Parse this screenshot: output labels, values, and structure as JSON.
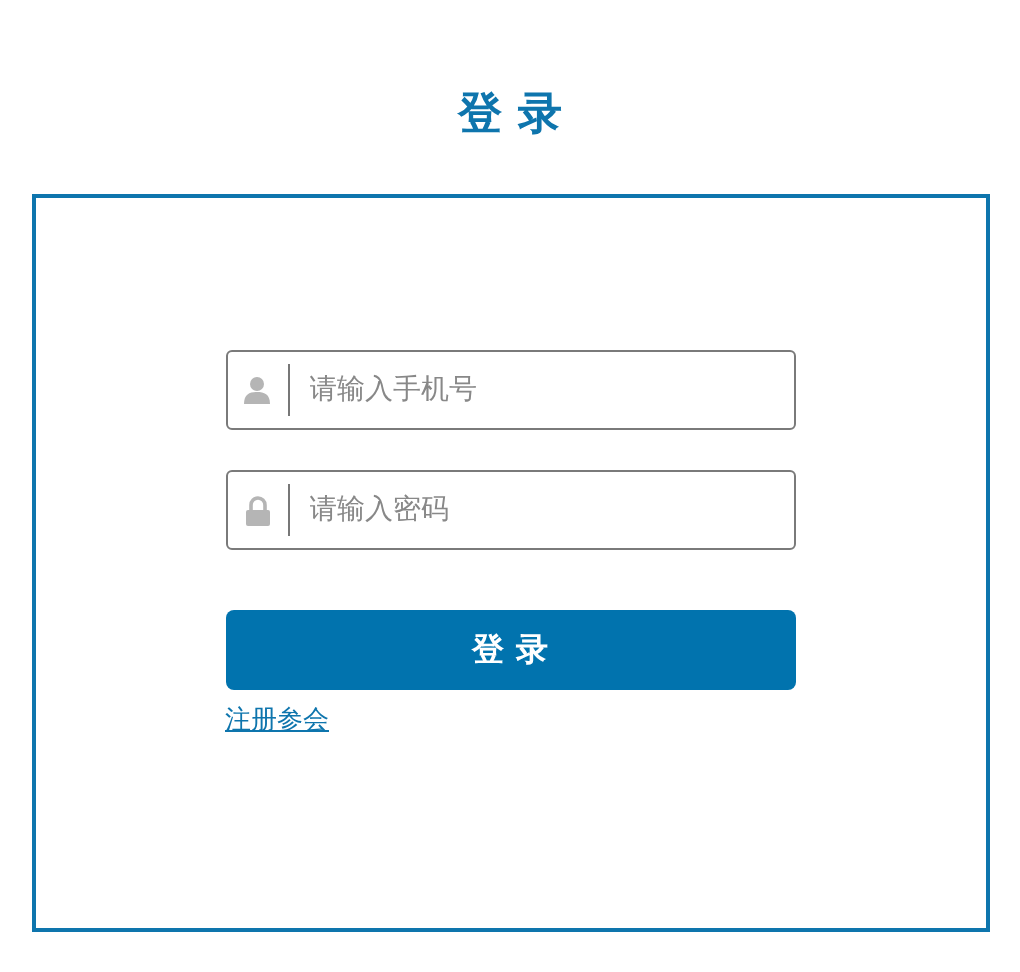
{
  "title": "登 录",
  "fields": [
    {
      "kind": "user",
      "placeholder": "请输入手机号"
    },
    {
      "kind": "password",
      "placeholder": "请输入密码"
    }
  ],
  "submit": "登 录",
  "register_link": "注册参会"
}
